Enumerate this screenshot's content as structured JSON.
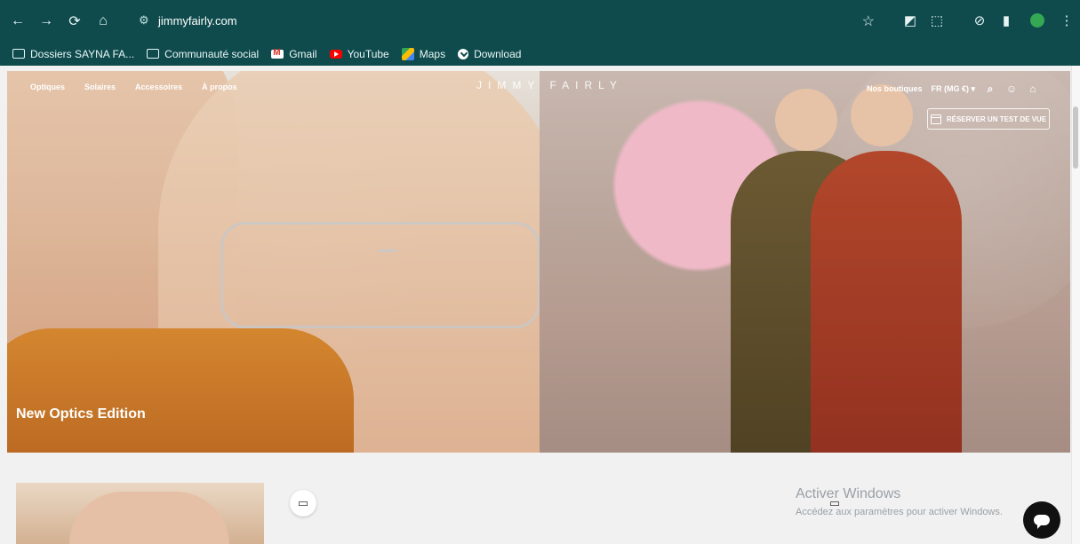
{
  "browser": {
    "url": "jimmyfairly.com",
    "bookmarks": [
      {
        "label": "Dossiers SAYNA FA...",
        "icon": "folder-icon"
      },
      {
        "label": "Communauté social",
        "icon": "folder-icon"
      },
      {
        "label": "Gmail",
        "icon": "gmail-icon"
      },
      {
        "label": "YouTube",
        "icon": "youtube-icon"
      },
      {
        "label": "Maps",
        "icon": "maps-icon"
      },
      {
        "label": "Download",
        "icon": "download-icon"
      }
    ]
  },
  "site": {
    "nav": [
      "Optiques",
      "Solaires",
      "Accessoires",
      "À propos"
    ],
    "logo": "JIMMY FAIRLY",
    "right": {
      "stores": "Nos boutiques",
      "locale": "FR (MG €)",
      "reserve": "RÉSERVER UN TEST DE VUE"
    },
    "hero_title": "New Optics Edition"
  },
  "windows_watermark": {
    "title": "Activer Windows",
    "subtitle": "Accédez aux paramètres pour activer Windows."
  },
  "colors": {
    "chrome": "#0f4b4d",
    "youtube_red": "#ff0000"
  }
}
